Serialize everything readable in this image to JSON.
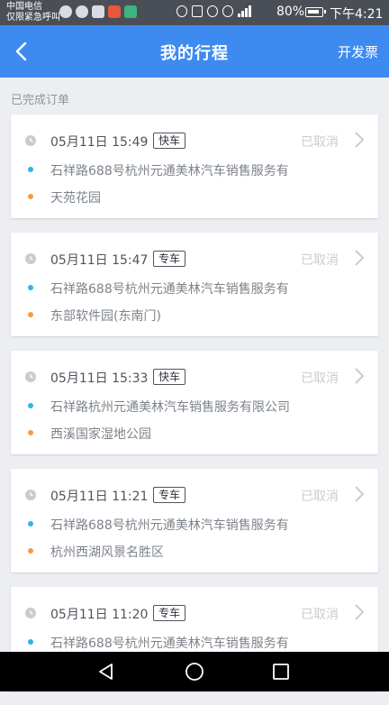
{
  "status_bar": {
    "carrier_line1": "中国电信",
    "carrier_line2": "仅限紧急呼叫",
    "battery": "80%",
    "time": "下午4:21"
  },
  "header": {
    "title": "我的行程",
    "action": "开发票"
  },
  "section_label": "已完成订单",
  "orders": [
    {
      "time": "05月11日 15:49",
      "car_type": "快车",
      "status": "已取消",
      "start": "石祥路688号杭州元通美林汽车销售服务有",
      "end": "天苑花园"
    },
    {
      "time": "05月11日 15:47",
      "car_type": "专车",
      "status": "已取消",
      "start": "石祥路688号杭州元通美林汽车销售服务有",
      "end": "东部软件园(东南门)"
    },
    {
      "time": "05月11日 15:33",
      "car_type": "快车",
      "status": "已取消",
      "start": "石祥路杭州元通美林汽车销售服务有限公司",
      "end": "西溪国家湿地公园"
    },
    {
      "time": "05月11日 11:21",
      "car_type": "专车",
      "status": "已取消",
      "start": "石祥路688号杭州元通美林汽车销售服务有",
      "end": "杭州西湖风景名胜区"
    },
    {
      "time": "05月11日 11:20",
      "car_type": "专车",
      "status": "已取消",
      "start": "石祥路688号杭州元通美林汽车销售服务有",
      "end": ""
    }
  ],
  "colors": {
    "header_bg": "#3d8af0",
    "start_dot": "#2cb5e8",
    "end_dot": "#f59a4a",
    "status_gray": "#c8ccd1"
  }
}
